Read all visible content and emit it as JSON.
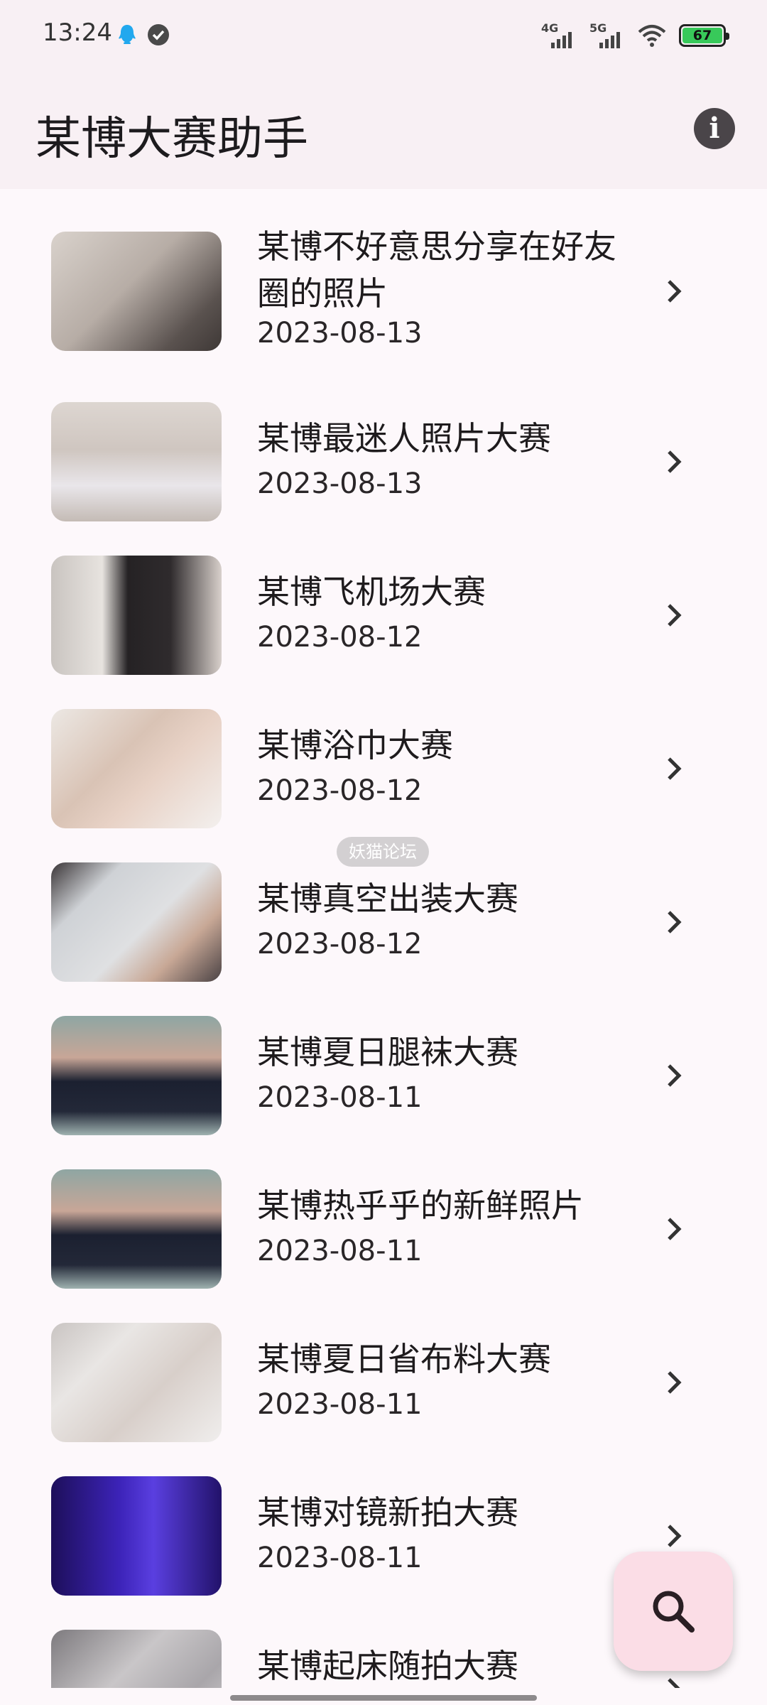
{
  "status_bar": {
    "time": "13:24",
    "net1": "4G",
    "net2": "5G",
    "battery": "67",
    "battery_color": "#38c95a"
  },
  "app_bar": {
    "title": "某博大赛助手",
    "info_icon": "info-icon"
  },
  "items": [
    {
      "title": "某博不好意思分享在好友圈的照片",
      "date": "2023-08-13"
    },
    {
      "title": "某博最迷人照片大赛",
      "date": "2023-08-13"
    },
    {
      "title": "某博飞机场大赛",
      "date": "2023-08-12"
    },
    {
      "title": "某博浴巾大赛",
      "date": "2023-08-12"
    },
    {
      "title": "某博真空出装大赛",
      "date": "2023-08-12"
    },
    {
      "title": "某博夏日腿袜大赛",
      "date": "2023-08-11"
    },
    {
      "title": "某博热乎乎的新鲜照片",
      "date": "2023-08-11"
    },
    {
      "title": "某博夏日省布料大赛",
      "date": "2023-08-11"
    },
    {
      "title": "某博对镜新拍大赛",
      "date": "2023-08-11"
    },
    {
      "title": "某博起床随拍大赛",
      "date": ""
    }
  ],
  "watermark": "妖猫论坛",
  "fab": {
    "icon": "search-icon",
    "color": "#fbdde6"
  }
}
